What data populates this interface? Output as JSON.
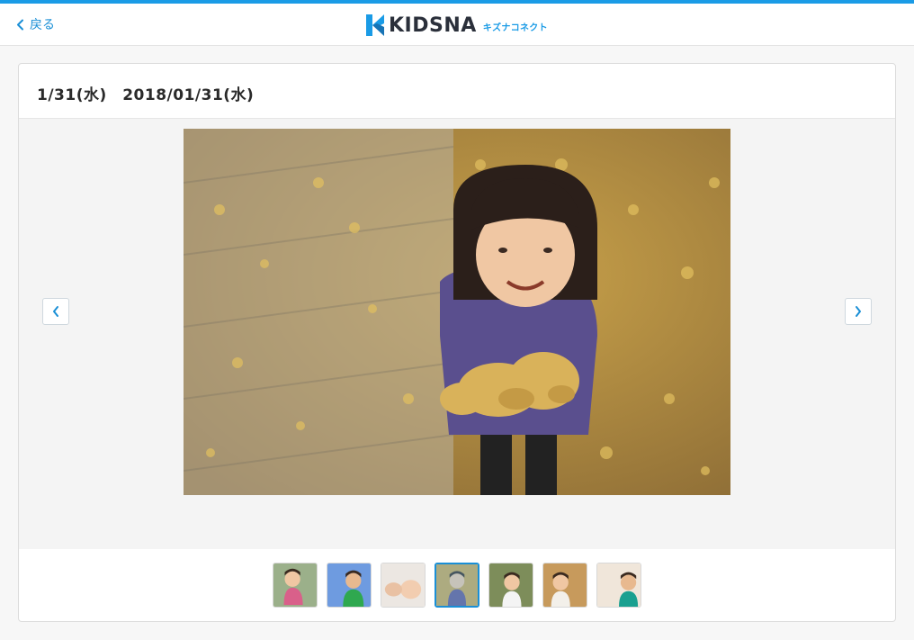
{
  "header": {
    "back_label": "戻る",
    "logo_text": "KIDSNA",
    "logo_sub": "キズナコネクト"
  },
  "card": {
    "title": "1/31(水)　2018/01/31(水)"
  },
  "viewer": {
    "prev_icon": "chevron-left-icon",
    "next_icon": "chevron-right-icon"
  },
  "thumbnails": {
    "count": 7,
    "active_index": 3
  },
  "colors": {
    "accent": "#1a9be6",
    "link": "#1a8fd6"
  }
}
